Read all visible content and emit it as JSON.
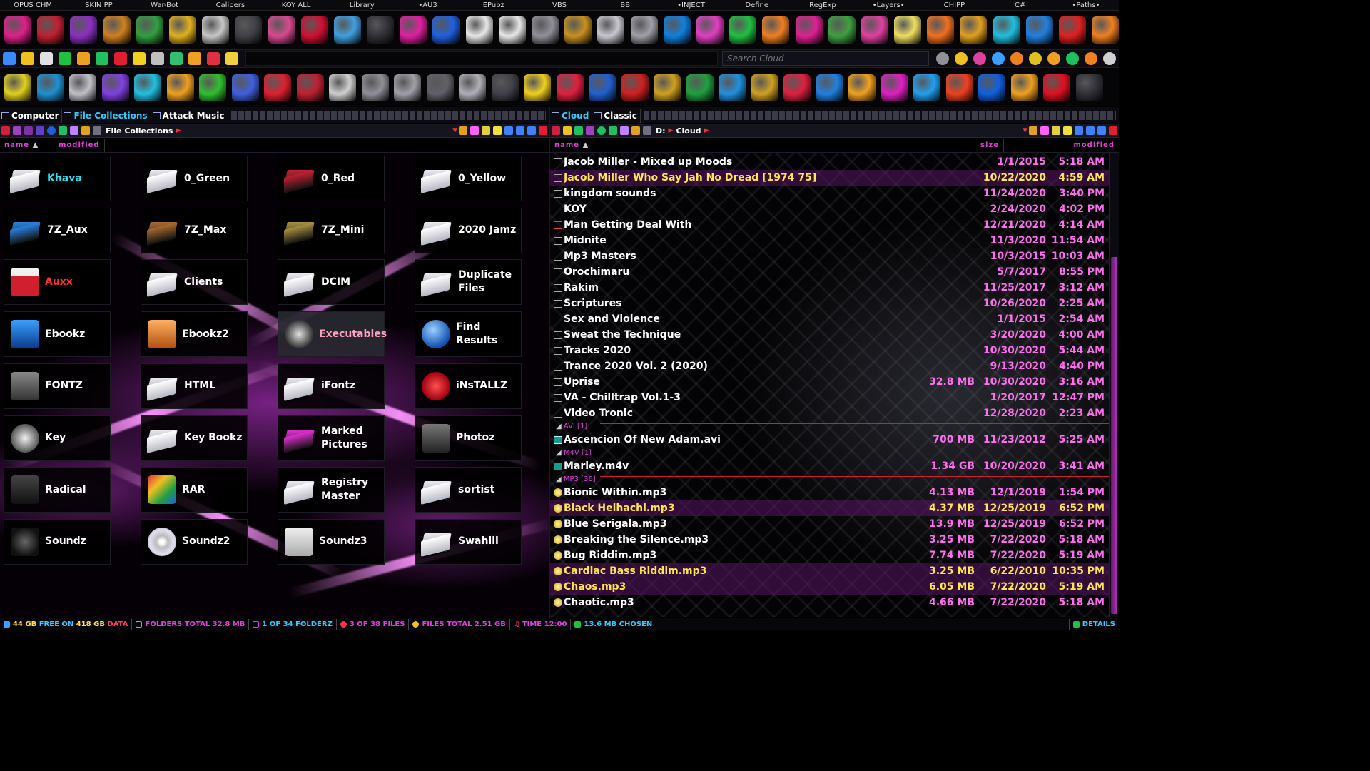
{
  "menu": [
    "OPUS CHM",
    "SKIN PP",
    "War-Bot",
    "Calipers",
    "KOY ALL",
    "Library",
    "•AU3",
    "EPubz",
    "VBS",
    "BB",
    "•INJECT",
    "Define",
    "RegExp",
    "•Layers•",
    "CHIPP",
    "C#",
    "•Paths•"
  ],
  "row1_icons": [
    {
      "name": "radiation-icon",
      "color": "#e0208a"
    },
    {
      "name": "red-disk-drive-icon",
      "color": "#c02030"
    },
    {
      "name": "purple-disk-drive-icon",
      "color": "#8a30c0"
    },
    {
      "name": "orange-disk-drive-icon",
      "color": "#d08020"
    },
    {
      "name": "green-disk-drive-icon",
      "color": "#30a040"
    },
    {
      "name": "key-icon",
      "color": "#e0b020"
    },
    {
      "name": "padlock-icon",
      "color": "#c8c8c8"
    },
    {
      "name": "terminal-icon",
      "color": "#404048"
    },
    {
      "name": "pink-box-icon",
      "color": "#d84a90"
    },
    {
      "name": "red-window-icon",
      "color": "#d01030"
    },
    {
      "name": "robot-face-icon",
      "color": "#40a0e0"
    },
    {
      "name": "monitor-icon",
      "color": "#303038"
    },
    {
      "name": "infinity-pink-icon",
      "color": "#e020a0"
    },
    {
      "name": "infinity-blue-icon",
      "color": "#2060e0"
    },
    {
      "name": "upload-white-icon",
      "color": "#e8e8e8"
    },
    {
      "name": "upload-white-2-icon",
      "color": "#e8e8e8"
    },
    {
      "name": "mask-icon",
      "color": "#909098"
    },
    {
      "name": "usb-gold-icon",
      "color": "#c89020"
    },
    {
      "name": "usb-white-icon",
      "color": "#c8c8d0"
    },
    {
      "name": "camera-icon",
      "color": "#a0a0a8"
    },
    {
      "name": "bluray-icon",
      "color": "#1080e0"
    },
    {
      "name": "stacked-windows-icon",
      "color": "#e040c0"
    },
    {
      "name": "green-down-chevron-icon",
      "color": "#20c040"
    },
    {
      "name": "layers-stack-icon",
      "color": "#f08020"
    },
    {
      "name": "pink-down-chevron-icon",
      "color": "#e02090"
    },
    {
      "name": "tree-icon",
      "color": "#40a040"
    },
    {
      "name": "pinwheel-icon",
      "color": "#e040a0"
    },
    {
      "name": "hand-icon",
      "color": "#f0e060"
    },
    {
      "name": "orange-fruit-icon",
      "color": "#f07020"
    },
    {
      "name": "books-icon",
      "color": "#e0a020"
    },
    {
      "name": "green-wave-icon",
      "color": "#20c0e0"
    },
    {
      "name": "book-shelf-icon",
      "color": "#2080e0"
    },
    {
      "name": "rubiks-cube-icon",
      "color": "#e02020"
    },
    {
      "name": "orange-ruler-icon",
      "color": "#f08020"
    }
  ],
  "row2_icons": [
    "app-grid-icon",
    "pencil-ruler-icon",
    "computer-icon",
    "circuit-icon",
    "glasses-icon",
    "edit-icon",
    "window-red-icon",
    "bulb-icon",
    "lock-small-icon",
    "network-icon",
    "branch-icon",
    "alarm-icon",
    "copy-icon"
  ],
  "search": {
    "placeholder": "Search Cloud"
  },
  "row2_right_icons": [
    "search-small-icon",
    "lightning-icon",
    "windows-logo-icon",
    "music-note-icon",
    "vlc-icon",
    "chrome-icon",
    "play-icon",
    "refresh-icon",
    "palm-icon",
    "xbox-icon"
  ],
  "row3_icons": [
    {
      "name": "triangle-app-icon",
      "color": "#e0d020"
    },
    {
      "name": "dvd-drive-icon",
      "color": "#2090d0"
    },
    {
      "name": "silver-drive-icon",
      "color": "#c0c0c8"
    },
    {
      "name": "purple-orb-icon",
      "color": "#8040e0"
    },
    {
      "name": "cube-outline-icon",
      "color": "#20c0e0"
    },
    {
      "name": "molecule-icon",
      "color": "#f0a020"
    },
    {
      "name": "green-layers-icon",
      "color": "#30c030"
    },
    {
      "name": "bar-graph-icon",
      "color": "#4060e0"
    },
    {
      "name": "red-atom-icon",
      "color": "#e02030"
    },
    {
      "name": "mixer-icon",
      "color": "#c02030"
    },
    {
      "name": "piano-icon",
      "color": "#d0d0d0"
    },
    {
      "name": "equalizer-icon",
      "color": "#909098"
    },
    {
      "name": "microphone-icon",
      "color": "#a0a0a8"
    },
    {
      "name": "headphones-icon",
      "color": "#606068"
    },
    {
      "name": "letter-g-icon",
      "color": "#b0b0b8"
    },
    {
      "name": "drawing-pad-icon",
      "color": "#404048"
    },
    {
      "name": "yellow-check-icon",
      "color": "#f0d020"
    },
    {
      "name": "red-notepad-icon",
      "color": "#e02040"
    },
    {
      "name": "blue-tablet-icon",
      "color": "#2060d0"
    },
    {
      "name": "red-book-icon",
      "color": "#d02020"
    },
    {
      "name": "gold-book-icon",
      "color": "#d0a020"
    },
    {
      "name": "green-book-icon",
      "color": "#20a040"
    },
    {
      "name": "blue-stack-icon",
      "color": "#2090e0"
    },
    {
      "name": "waveform-gold-icon",
      "color": "#d0a020"
    },
    {
      "name": "waveform-red-icon",
      "color": "#e02040"
    },
    {
      "name": "waveform-blue-icon",
      "color": "#2080e0"
    },
    {
      "name": "envelope-icon",
      "color": "#f0a020"
    },
    {
      "name": "rainbow-ring-icon",
      "color": "#e020c0"
    },
    {
      "name": "blue-triangle-icon",
      "color": "#20a0f0"
    },
    {
      "name": "flame-badge-icon",
      "color": "#f04020"
    },
    {
      "name": "blue-drop-icon",
      "color": "#1060e0"
    },
    {
      "name": "v-logo-icon",
      "color": "#f0a020"
    },
    {
      "name": "red-ball-icon",
      "color": "#e01020"
    },
    {
      "name": "black-lock-icon",
      "color": "#303038"
    }
  ],
  "left_pane": {
    "tabs": [
      "Computer",
      "File Collections",
      "Attack Music"
    ],
    "path": "File Collections",
    "columns": [
      "name",
      "modified"
    ],
    "tiles": [
      {
        "label": "Khava",
        "color": "#30e0f0",
        "icon": "white-folder-icon"
      },
      {
        "label": "0_Green",
        "color": "#ffffff",
        "icon": "white-folder-icon"
      },
      {
        "label": "0_Red",
        "color": "#ffffff",
        "icon": "red-folder-icon"
      },
      {
        "label": "0_Yellow",
        "color": "#ffffff",
        "icon": "white-folder-icon"
      },
      {
        "label": "7Z_Aux",
        "color": "#ffffff",
        "icon": "blue-folder-icon"
      },
      {
        "label": "7Z_Max",
        "color": "#ffffff",
        "icon": "bronze-folder-icon"
      },
      {
        "label": "7Z_Mini",
        "color": "#ffffff",
        "icon": "gold-folder-icon"
      },
      {
        "label": "2020 Jamz",
        "color": "#ffffff",
        "icon": "white-folder-icon"
      },
      {
        "label": "Auxx",
        "color": "#ff3030",
        "icon": "mail-drive-icon"
      },
      {
        "label": "Clients",
        "color": "#ffffff",
        "icon": "white-folder-icon"
      },
      {
        "label": "DCIM",
        "color": "#ffffff",
        "icon": "white-folder-icon"
      },
      {
        "label": "Duplicate\nFiles",
        "color": "#ffffff",
        "icon": "white-folder-icon"
      },
      {
        "label": "Ebookz",
        "color": "#ffffff",
        "icon": "blue-book-icon"
      },
      {
        "label": "Ebookz2",
        "color": "#ffffff",
        "icon": "orange-book-icon"
      },
      {
        "label": "Executables",
        "color": "#ffa0c0",
        "icon": "exe-drive-icon"
      },
      {
        "label": "Find Results",
        "color": "#ffffff",
        "icon": "globe-icon"
      },
      {
        "label": "FONTZ",
        "color": "#ffffff",
        "icon": "font-icon"
      },
      {
        "label": "HTML",
        "color": "#ffffff",
        "icon": "white-folder-icon"
      },
      {
        "label": "iFontz",
        "color": "#ffffff",
        "icon": "white-folder-icon"
      },
      {
        "label": "iNsTALLZ",
        "color": "#ffffff",
        "icon": "install-red-icon"
      },
      {
        "label": "Key",
        "color": "#ffffff",
        "icon": "key-disk-icon"
      },
      {
        "label": "Key Bookz",
        "color": "#ffffff",
        "icon": "white-folder-icon"
      },
      {
        "label": "Marked\nPictures",
        "color": "#ffffff",
        "icon": "magenta-folder-icon"
      },
      {
        "label": "Photoz",
        "color": "#ffffff",
        "icon": "camera-icon"
      },
      {
        "label": "Radical",
        "color": "#ffffff",
        "icon": "download-folder-icon"
      },
      {
        "label": "RAR",
        "color": "#ffffff",
        "icon": "rar-icon"
      },
      {
        "label": "Registry\nMaster",
        "color": "#ffffff",
        "icon": "white-folder-icon"
      },
      {
        "label": "sortist",
        "color": "#ffffff",
        "icon": "white-folder-icon"
      },
      {
        "label": "Soundz",
        "color": "#ffffff",
        "icon": "headphones-icon"
      },
      {
        "label": "Soundz2",
        "color": "#ffffff",
        "icon": "cd-icon"
      },
      {
        "label": "Soundz3",
        "color": "#ffffff",
        "icon": "sync-drive-icon"
      },
      {
        "label": "Swahili",
        "color": "#ffffff",
        "icon": "white-folder-icon"
      }
    ]
  },
  "right_pane": {
    "tabs": [
      "Cloud",
      "Classic"
    ],
    "path": [
      "D:",
      "Cloud"
    ],
    "columns": [
      "name",
      "size",
      "modified"
    ],
    "rows": [
      {
        "type": "folder",
        "name": "Jacob Miller - Mixed up Moods",
        "size": "",
        "date": "1/1/2015",
        "time": "5:18 AM"
      },
      {
        "type": "folder",
        "name": "Jacob Miller Who Say Jah No Dread [1974 75]",
        "size": "",
        "date": "10/22/2020",
        "time": "4:59 AM",
        "selected": true
      },
      {
        "type": "folder",
        "name": "kingdom sounds",
        "size": "",
        "date": "11/24/2020",
        "time": "3:40 PM"
      },
      {
        "type": "folder",
        "name": "KOY",
        "size": "",
        "date": "2/24/2020",
        "time": "4:02 PM"
      },
      {
        "type": "folder-red",
        "name": "Man Getting Deal With",
        "size": "",
        "date": "12/21/2020",
        "time": "4:14 AM"
      },
      {
        "type": "folder",
        "name": "Midnite",
        "size": "",
        "date": "11/3/2020",
        "time": "11:54 AM"
      },
      {
        "type": "folder",
        "name": "Mp3 Masters",
        "size": "",
        "date": "10/3/2015",
        "time": "10:03 AM"
      },
      {
        "type": "folder",
        "name": "Orochimaru",
        "size": "",
        "date": "5/7/2017",
        "time": "8:55 PM"
      },
      {
        "type": "folder",
        "name": "Rakim",
        "size": "",
        "date": "11/25/2017",
        "time": "3:12 AM"
      },
      {
        "type": "folder",
        "name": "Scriptures",
        "size": "",
        "date": "10/26/2020",
        "time": "2:25 AM"
      },
      {
        "type": "folder",
        "name": "Sex and Violence",
        "size": "",
        "date": "1/1/2015",
        "time": "2:54 AM"
      },
      {
        "type": "folder",
        "name": "Sweat the Technique",
        "size": "",
        "date": "3/20/2020",
        "time": "4:00 AM"
      },
      {
        "type": "folder",
        "name": "Tracks 2020",
        "size": "",
        "date": "10/30/2020",
        "time": "5:44 AM"
      },
      {
        "type": "folder",
        "name": "Trance 2020 Vol. 2 (2020)",
        "size": "",
        "date": "9/13/2020",
        "time": "4:40 PM"
      },
      {
        "type": "folder",
        "name": "Uprise",
        "size": "32.8 MB",
        "date": "10/30/2020",
        "time": "3:16 AM"
      },
      {
        "type": "folder",
        "name": "VA - Chilltrap Vol.1-3",
        "size": "",
        "date": "1/20/2017",
        "time": "12:47 PM"
      },
      {
        "type": "folder",
        "name": "Video Tronic",
        "size": "",
        "date": "12/28/2020",
        "time": "2:23 AM"
      },
      {
        "type": "group",
        "name": "AVI [1]"
      },
      {
        "type": "avi",
        "name": "Ascencion Of New Adam.avi",
        "size": "700 MB",
        "date": "11/23/2012",
        "time": "5:25 AM"
      },
      {
        "type": "group",
        "name": "M4V [1]"
      },
      {
        "type": "avi",
        "name": "Marley.m4v",
        "size": "1.34 GB",
        "date": "10/20/2020",
        "time": "3:41 AM"
      },
      {
        "type": "group",
        "name": "MP3 [36]"
      },
      {
        "type": "mp3",
        "name": "Bionic Within.mp3",
        "size": "4.13 MB",
        "date": "12/1/2019",
        "time": "1:54 PM"
      },
      {
        "type": "mp3",
        "name": "Black Heihachi.mp3",
        "size": "4.37 MB",
        "date": "12/25/2019",
        "time": "6:52 PM",
        "selected": true
      },
      {
        "type": "mp3",
        "name": "Blue Serigala.mp3",
        "size": "13.9 MB",
        "date": "12/25/2019",
        "time": "6:52 PM"
      },
      {
        "type": "mp3",
        "name": "Breaking the Silence.mp3",
        "size": "3.25 MB",
        "date": "7/22/2020",
        "time": "5:18 AM"
      },
      {
        "type": "mp3",
        "name": "Bug Riddim.mp3",
        "size": "7.74 MB",
        "date": "7/22/2020",
        "time": "5:19 AM"
      },
      {
        "type": "mp3",
        "name": "Cardiac Bass Riddim.mp3",
        "size": "3.25 MB",
        "date": "6/22/2010",
        "time": "10:35 PM",
        "selected": true
      },
      {
        "type": "mp3",
        "name": "Chaos.mp3",
        "size": "6.05 MB",
        "date": "7/22/2020",
        "time": "5:19 AM",
        "selected": true
      },
      {
        "type": "mp3",
        "name": "Chaotic.mp3",
        "size": "4.66 MB",
        "date": "7/22/2020",
        "time": "5:18 AM"
      }
    ]
  },
  "status": {
    "free_a": "44 GB",
    "free_label": "FREE ON",
    "free_b": "418 GB",
    "drive": "DATA",
    "folders_total": "FOLDERS TOTAL 32.8 MB",
    "folders_count": "1 OF 34 FOLDERZ",
    "files_count": "3 OF 38 FILES",
    "files_total": "FILES TOTAL 2.51 GB",
    "time": "TIME 12:00",
    "chosen": "13.6 MB CHOSEN",
    "details": "DETAILS"
  },
  "colors": {
    "accent": "#e23fdc",
    "selected_text": "#ffe64a",
    "cyan": "#30e0f0",
    "red": "#ff3030"
  }
}
